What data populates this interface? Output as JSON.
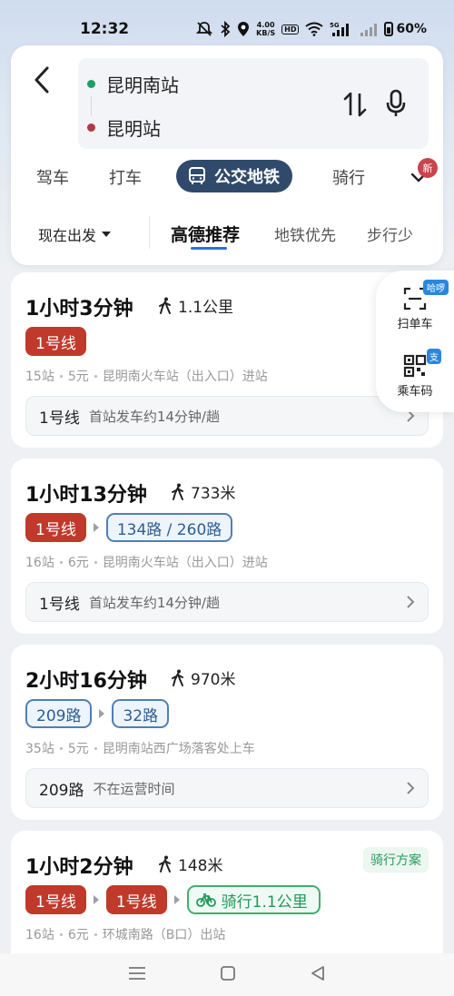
{
  "status_bar": {
    "time": "12:32",
    "speed_value": "4.00",
    "speed_unit": "KB/S",
    "hd": "HD",
    "network": "5G",
    "battery": "60%"
  },
  "header": {
    "from_station": "昆明南站",
    "to_station": "昆明站",
    "modes": [
      {
        "label": "驾车"
      },
      {
        "label": "打车"
      },
      {
        "label": "公交地铁",
        "active": true
      },
      {
        "label": "骑行"
      }
    ],
    "new_badge": "新",
    "depart_label": "现在出发",
    "sort_tabs": [
      {
        "label": "高德推荐",
        "active": true
      },
      {
        "label": "地铁优先"
      },
      {
        "label": "步行少"
      }
    ]
  },
  "quick": {
    "scan_label": "扫单车",
    "scan_badge": "哈啰",
    "code_label": "乘车码",
    "code_badge": "支"
  },
  "routes": [
    {
      "duration": "1小时3分钟",
      "walk": "1.1公里",
      "lines": [
        {
          "label": "1号线",
          "kind": "subway"
        }
      ],
      "stops": "15站",
      "fare": "5元",
      "entry": "昆明南火车站（出入口）进站",
      "detail_line": "1号线",
      "detail_text": "首站发车约14分钟/趟"
    },
    {
      "duration": "1小时13分钟",
      "walk": "733米",
      "lines": [
        {
          "label": "1号线",
          "kind": "subway"
        },
        {
          "label": "134路 / 260路",
          "kind": "bus"
        }
      ],
      "stops": "16站",
      "fare": "6元",
      "entry": "昆明南火车站（出入口）进站",
      "detail_line": "1号线",
      "detail_text": "首站发车约14分钟/趟"
    },
    {
      "duration": "2小时16分钟",
      "walk": "970米",
      "lines": [
        {
          "label": "209路",
          "kind": "bus"
        },
        {
          "label": "32路",
          "kind": "bus"
        }
      ],
      "stops": "35站",
      "fare": "5元",
      "entry": "昆明南站西广场落客处上车",
      "detail_line": "209路",
      "detail_text": "不在运营时间"
    },
    {
      "duration": "1小时2分钟",
      "walk": "148米",
      "tag": "骑行方案",
      "lines": [
        {
          "label": "1号线",
          "kind": "subway"
        },
        {
          "label": "1号线",
          "kind": "subway"
        },
        {
          "label": "骑行1.1公里",
          "kind": "bike"
        }
      ],
      "stops": "16站",
      "fare": "6元",
      "entry": "环城南路（B口）出站"
    }
  ],
  "colors": {
    "accent": "#2f4a6b",
    "subway": "#c0392b",
    "bus": "#4f7fb6",
    "bike": "#3fae70"
  }
}
